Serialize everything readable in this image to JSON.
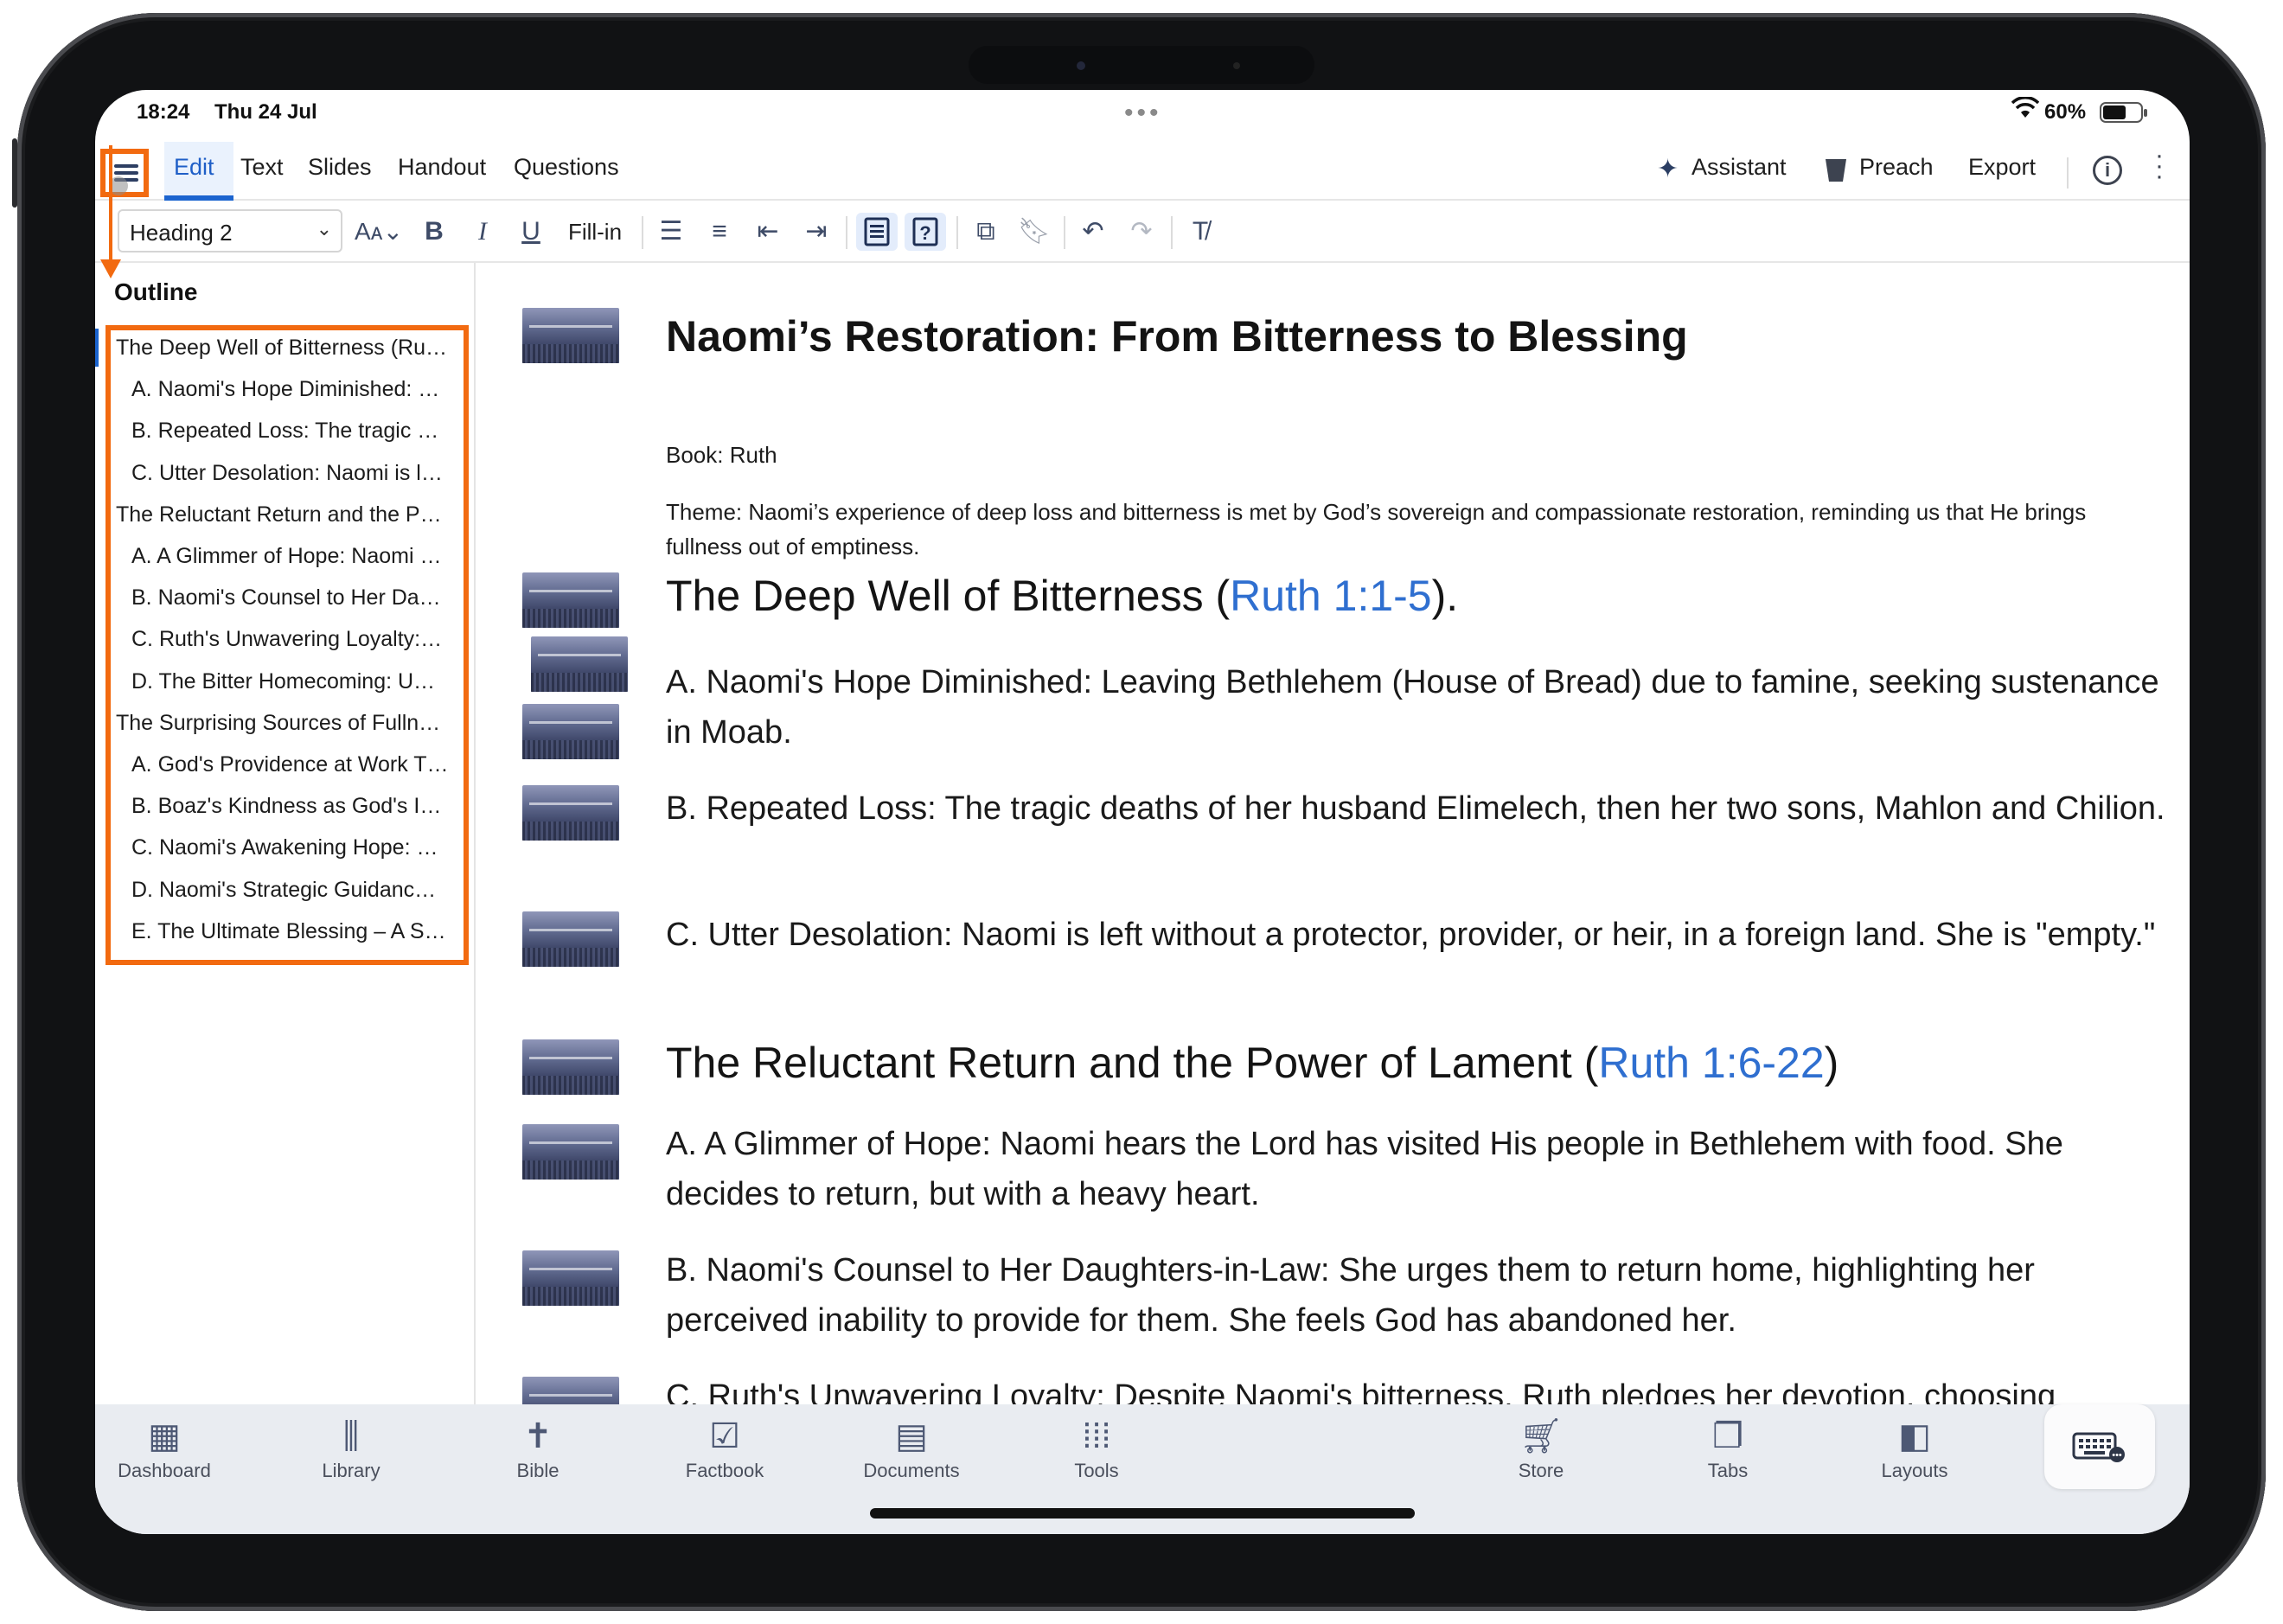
{
  "status": {
    "time": "18:24",
    "date": "Thu 24 Jul",
    "battery": "60%",
    "battery_level": 0.6
  },
  "menu": {
    "tabs": [
      "Edit",
      "Text",
      "Slides",
      "Handout",
      "Questions"
    ],
    "assistant": "Assistant",
    "preach": "Preach",
    "export": "Export"
  },
  "toolbar": {
    "style_value": "Heading 2",
    "fill_in": "Fill-in",
    "icons": [
      "font-size-icon",
      "bold-icon",
      "italic-icon",
      "underline-icon",
      "bulleted-list-icon",
      "numbered-list-icon",
      "outdent-icon",
      "indent-icon",
      "paragraph-view-icon",
      "question-view-icon",
      "add-slide-icon",
      "bookmark-icon",
      "undo-icon",
      "redo-icon",
      "clear-format-icon"
    ]
  },
  "outline": {
    "title": "Outline",
    "items": [
      {
        "text": "The Deep Well of Bitterness (Ru…",
        "level": 1
      },
      {
        "text": "A. Naomi's Hope Diminished: …",
        "level": 2
      },
      {
        "text": "B. Repeated Loss: The tragic d…",
        "level": 2
      },
      {
        "text": "C. Utter Desolation: Naomi is l…",
        "level": 2
      },
      {
        "text": "The Reluctant Return and the P…",
        "level": 1
      },
      {
        "text": "A. A Glimmer of Hope: Naomi …",
        "level": 2
      },
      {
        "text": "B. Naomi's Counsel to Her Da…",
        "level": 2
      },
      {
        "text": "C. Ruth's Unwavering Loyalty:…",
        "level": 2
      },
      {
        "text": "D. The Bitter Homecoming: U…",
        "level": 2
      },
      {
        "text": "The Surprising Sources of Fulln…",
        "level": 1
      },
      {
        "text": "A. God's Providence at Work T…",
        "level": 2
      },
      {
        "text": "B. Boaz's Kindness as God's In…",
        "level": 2
      },
      {
        "text": "C. Naomi's Awakening Hope: …",
        "level": 2
      },
      {
        "text": "D. Naomi's Strategic Guidanc…",
        "level": 2
      },
      {
        "text": "E. The Ultimate Blessing – A S…",
        "level": 2
      }
    ]
  },
  "document": {
    "title": "Naomi’s Restoration: From Bitterness to Blessing",
    "book": "Book: Ruth",
    "theme": "Theme: Naomi’s experience of deep loss and bitterness is met by God’s sovereign and compassionate restoration, reminding us that He brings fullness out of emptiness.",
    "section1": {
      "heading": "The Deep Well of Bitterness (",
      "ref": "Ruth 1:1-5",
      "tail": ")."
    },
    "p1a": "A. Naomi's Hope Diminished: Leaving Bethlehem (House of Bread) due to famine, seeking sustenance in Moab.",
    "p1b": "B. Repeated Loss: The tragic deaths of her husband Elimelech, then her two sons, Mahlon and Chilion.",
    "p1c": "C. Utter Desolation: Naomi is left without a protector, provider, or heir, in a foreign land. She is \"empty.\"",
    "section2": {
      "heading": "The Reluctant Return and the Power of Lament (",
      "ref": "Ruth 1:6-22",
      "tail": ")"
    },
    "p2a": "A. A Glimmer of Hope: Naomi hears the Lord has visited His people in Bethlehem with food. She decides to return, but with a heavy heart.",
    "p2b": "B. Naomi's Counsel to Her Daughters-in-Law: She urges them to return home, highlighting her perceived inability to provide for them. She feels God has abandoned her.",
    "p2c": "C. Ruth's Unwavering Loyalty: Despite Naomi's bitterness, Ruth pledges her devotion, choosing"
  },
  "tabbar": [
    {
      "label": "Dashboard",
      "icon": "dashboard-icon"
    },
    {
      "label": "Library",
      "icon": "library-icon"
    },
    {
      "label": "Bible",
      "icon": "bible-icon"
    },
    {
      "label": "Factbook",
      "icon": "factbook-icon"
    },
    {
      "label": "Documents",
      "icon": "documents-icon"
    },
    {
      "label": "Tools",
      "icon": "tools-icon"
    },
    {
      "label": "Store",
      "icon": "store-icon"
    },
    {
      "label": "Tabs",
      "icon": "tabs-icon"
    },
    {
      "label": "Layouts",
      "icon": "layouts-icon"
    }
  ],
  "colors": {
    "accent": "#1b64cf",
    "annotation": "#f26a10",
    "link": "#2f6fd0"
  }
}
